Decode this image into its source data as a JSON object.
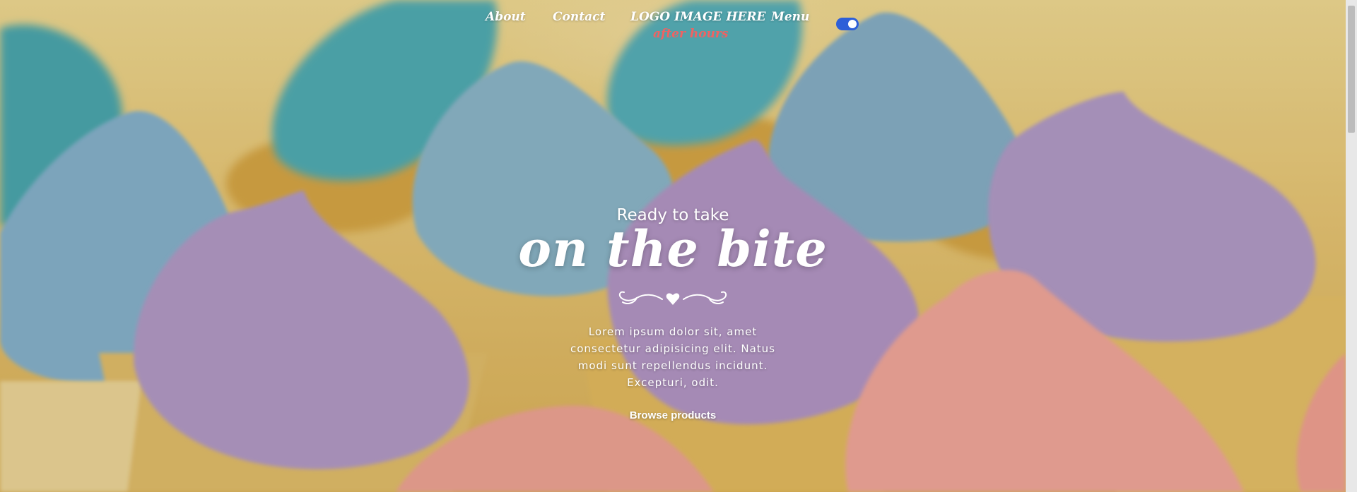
{
  "nav": {
    "about": "About",
    "contact": "Contact",
    "logo": "LOGO IMAGE HERE",
    "logo_sub": "after hours",
    "menu": "Menu",
    "theme_toggle": {
      "state": "on",
      "color": "#2d5fd8"
    }
  },
  "hero": {
    "pretitle": "Ready to take",
    "title": "on the bite",
    "description": "Lorem ipsum dolor sit, amet consectetur adipisicing elit. Natus modi sunt repellendus incidunt. Excepturi, odit.",
    "cta": "Browse products",
    "divider_icon": "heart-flourish-icon"
  },
  "colors": {
    "frosting_teal": "#5bb3b8",
    "frosting_blue": "#8fb7cf",
    "frosting_purple": "#b79bc8",
    "frosting_pink": "#f2a89a",
    "cake": "#e6b85a",
    "accent_red": "#f06262"
  }
}
